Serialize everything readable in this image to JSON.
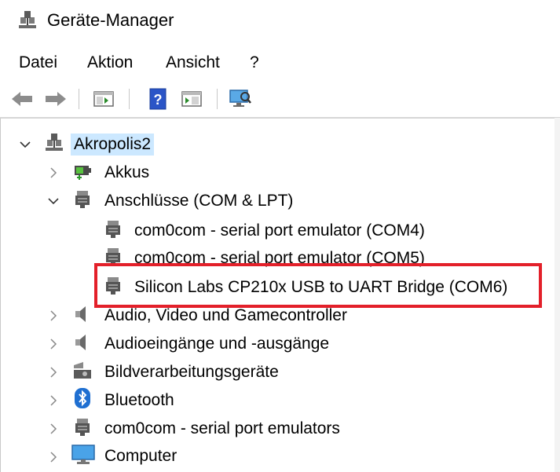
{
  "window": {
    "title": "Geräte-Manager",
    "icon": "device-manager-icon"
  },
  "menu": [
    {
      "label": "Datei"
    },
    {
      "label": "Aktion"
    },
    {
      "label": "Ansicht"
    },
    {
      "label": "?"
    }
  ],
  "toolbar": [
    {
      "name": "back-button",
      "icon": "arrow-left-icon"
    },
    {
      "name": "forward-button",
      "icon": "arrow-right-icon"
    },
    {
      "name": "show-hide-console-tree-button",
      "icon": "console-tree-icon"
    },
    {
      "name": "help-button",
      "icon": "help-icon"
    },
    {
      "name": "properties-button",
      "icon": "properties-icon"
    },
    {
      "name": "scan-hardware-button",
      "icon": "monitor-scan-icon"
    }
  ],
  "tree": {
    "root": {
      "label": "Akropolis2",
      "expanded": true,
      "icon": "computer-network-icon"
    },
    "items": [
      {
        "label": "Akkus",
        "expanded": false,
        "icon": "battery-icon",
        "level": 1
      },
      {
        "label": "Anschlüsse (COM & LPT)",
        "expanded": true,
        "icon": "port-icon",
        "level": 1
      },
      {
        "label": "com0com - serial port emulator (COM4)",
        "icon": "port-icon",
        "level": 2
      },
      {
        "label": "com0com - serial port emulator (COM5)",
        "icon": "port-icon",
        "level": 2
      },
      {
        "label": "Silicon Labs CP210x USB to UART Bridge (COM6)",
        "icon": "port-icon",
        "level": 2,
        "highlighted": true
      },
      {
        "label": "Audio, Video und Gamecontroller",
        "expanded": false,
        "icon": "speaker-icon",
        "level": 1
      },
      {
        "label": "Audioeingänge und -ausgänge",
        "expanded": false,
        "icon": "speaker-icon",
        "level": 1
      },
      {
        "label": "Bildverarbeitungsgeräte",
        "expanded": false,
        "icon": "camera-icon",
        "level": 1
      },
      {
        "label": "Bluetooth",
        "expanded": false,
        "icon": "bluetooth-icon",
        "level": 1
      },
      {
        "label": "com0com - serial port emulators",
        "expanded": false,
        "icon": "port-icon",
        "level": 1
      },
      {
        "label": "Computer",
        "expanded": false,
        "icon": "monitor-icon",
        "level": 1
      }
    ]
  },
  "colors": {
    "highlight_border": "#e3202a",
    "root_selection": "#cce8ff"
  }
}
